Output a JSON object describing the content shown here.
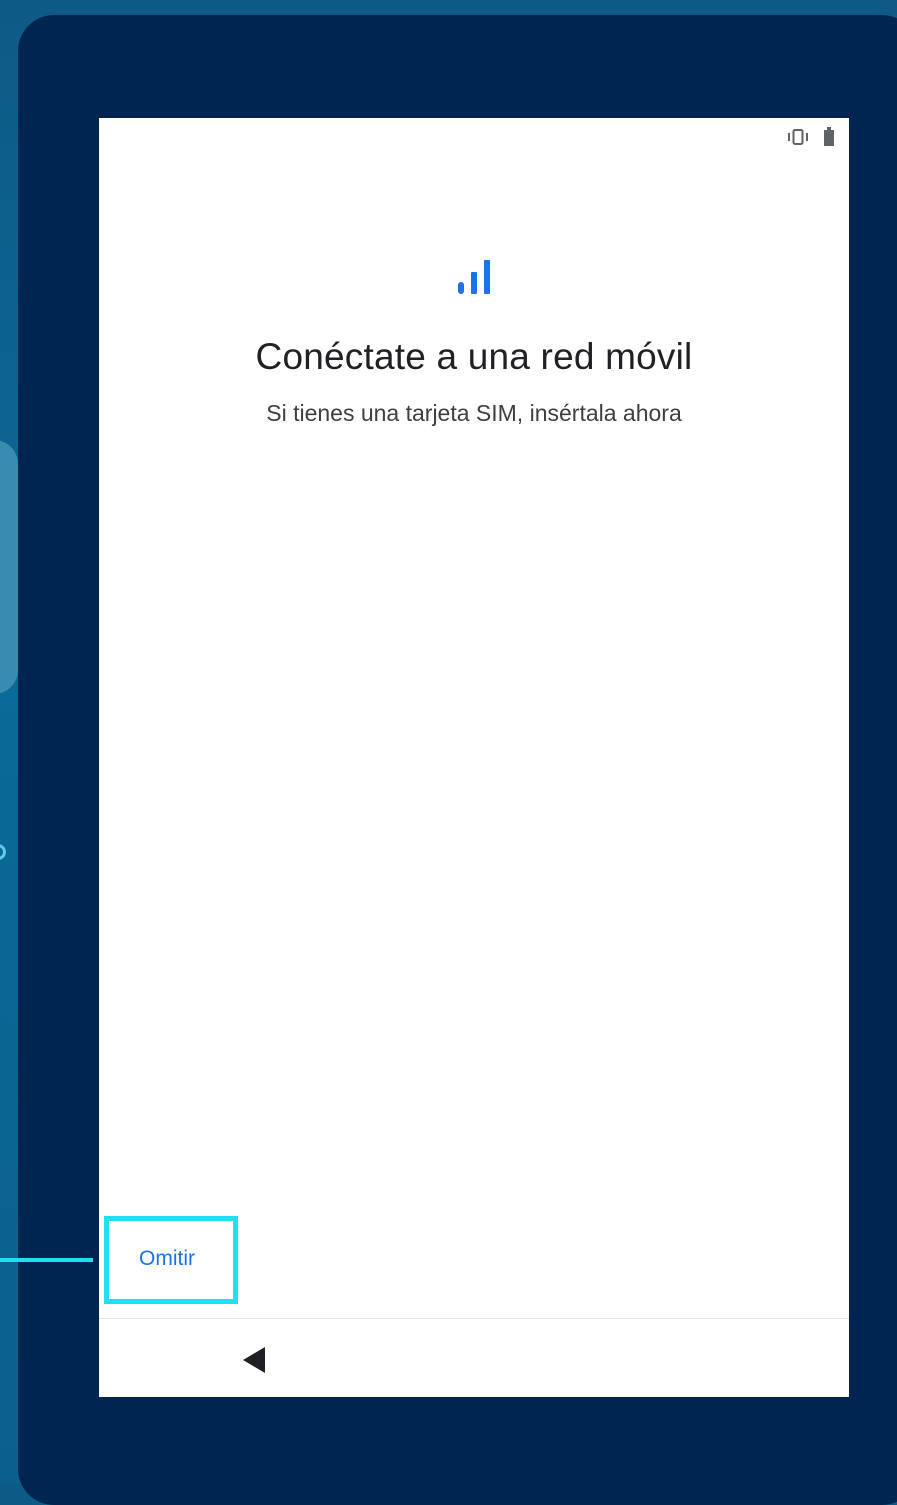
{
  "screen": {
    "title": "Conéctate a una red móvil",
    "subtitle": "Si tienes una tarjeta SIM, insértala ahora",
    "header_icon": "signal-bars-icon",
    "accent_color": "#1a73e8"
  },
  "status_bar": {
    "icons": [
      "vibrate-icon",
      "battery-icon"
    ]
  },
  "actions": {
    "skip_label": "Omitir"
  },
  "navigation": {
    "back_icon": "back-triangle-icon"
  },
  "annotation": {
    "highlight_color": "#1fe0f0"
  }
}
